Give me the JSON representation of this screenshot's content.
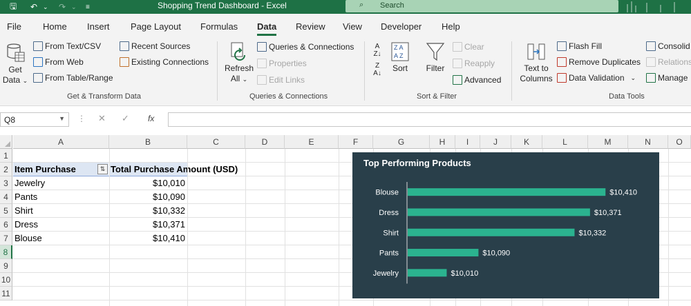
{
  "titlebar": {
    "title": "Shopping Trend Dashboard  -  Excel",
    "search_placeholder": "Search"
  },
  "tabs": [
    "File",
    "Home",
    "Insert",
    "Page Layout",
    "Formulas",
    "Data",
    "Review",
    "View",
    "Developer",
    "Help"
  ],
  "active_tab": "Data",
  "ribbon": {
    "get_transform": {
      "get_data_line1": "Get",
      "get_data_line2": "Data",
      "from_text_csv": "From Text/CSV",
      "from_web": "From Web",
      "from_table_range": "From Table/Range",
      "recent_sources": "Recent Sources",
      "existing_connections": "Existing Connections",
      "label": "Get & Transform Data"
    },
    "queries": {
      "refresh_line1": "Refresh",
      "refresh_line2": "All",
      "queries_connections": "Queries & Connections",
      "properties": "Properties",
      "edit_links": "Edit Links",
      "label": "Queries & Connections"
    },
    "sort_filter": {
      "sort": "Sort",
      "filter": "Filter",
      "clear": "Clear",
      "reapply": "Reapply",
      "advanced": "Advanced",
      "label": "Sort & Filter"
    },
    "data_tools": {
      "text_to_columns_line1": "Text to",
      "text_to_columns_line2": "Columns",
      "flash_fill": "Flash Fill",
      "remove_duplicates": "Remove Duplicates",
      "data_validation": "Data Validation",
      "consolidate": "Consolid",
      "relationships": "Relations",
      "manage": "Manage",
      "label": "Data Tools"
    }
  },
  "formula_bar": {
    "name_box": "Q8",
    "fx": "fx",
    "content": ""
  },
  "grid": {
    "columns": [
      "A",
      "B",
      "C",
      "D",
      "E",
      "F",
      "G",
      "H",
      "I",
      "J",
      "K",
      "L",
      "M",
      "N",
      "O"
    ],
    "rows": [
      "1",
      "2",
      "3",
      "4",
      "5",
      "6",
      "7",
      "8",
      "9",
      "10",
      "11"
    ],
    "selected_row": "8",
    "table": {
      "headers": [
        "Item Purchase",
        "Total Purchase Amount (USD)"
      ],
      "rows": [
        [
          "Jewelry",
          "$10,010"
        ],
        [
          "Pants",
          "$10,090"
        ],
        [
          "Shirt",
          "$10,332"
        ],
        [
          "Dress",
          "$10,371"
        ],
        [
          "Blouse",
          "$10,410"
        ]
      ]
    }
  },
  "chart_data": {
    "type": "bar",
    "orientation": "horizontal",
    "title": "Top Performing Products",
    "categories": [
      "Blouse",
      "Dress",
      "Shirt",
      "Pants",
      "Jewelry"
    ],
    "values": [
      10410,
      10371,
      10332,
      10090,
      10010
    ],
    "labels": [
      "$10,410",
      "$10,371",
      "$10,332",
      "$10,090",
      "$10,010"
    ],
    "xlim": [
      9910,
      10460
    ],
    "bar_color": "#2bb38f",
    "background": "#293f4a",
    "grid": false,
    "legend": "none"
  }
}
